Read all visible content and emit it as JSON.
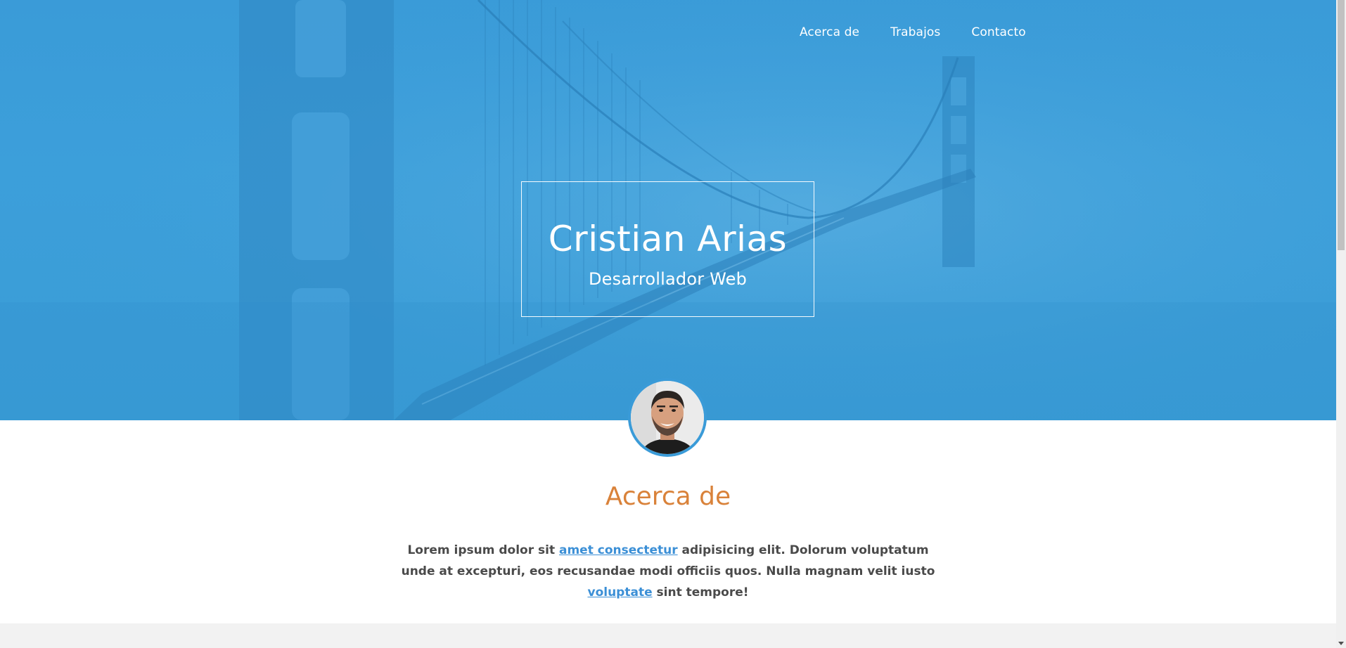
{
  "nav": {
    "items": [
      "Acerca de",
      "Trabajos",
      "Contacto"
    ]
  },
  "hero": {
    "name": "Cristian Arias",
    "role": "Desarrollador Web"
  },
  "about": {
    "title": "Acerca de",
    "text_1": "Lorem ipsum dolor sit ",
    "link_1": "amet consectetur",
    "text_2": " adipisicing elit. Dolorum voluptatum unde at excepturi, eos recusandae modi officiis quos. Nulla magnam velit iusto ",
    "link_2": "voluptate",
    "text_3": " sint tempore!"
  },
  "colors": {
    "hero_blue": "#3a9bd8",
    "accent_orange": "#d9823a",
    "link_blue": "#3b8fd6",
    "body_text": "#4a4a4a"
  },
  "icons": {
    "scroll_down": "scroll-down-arrow-icon"
  }
}
